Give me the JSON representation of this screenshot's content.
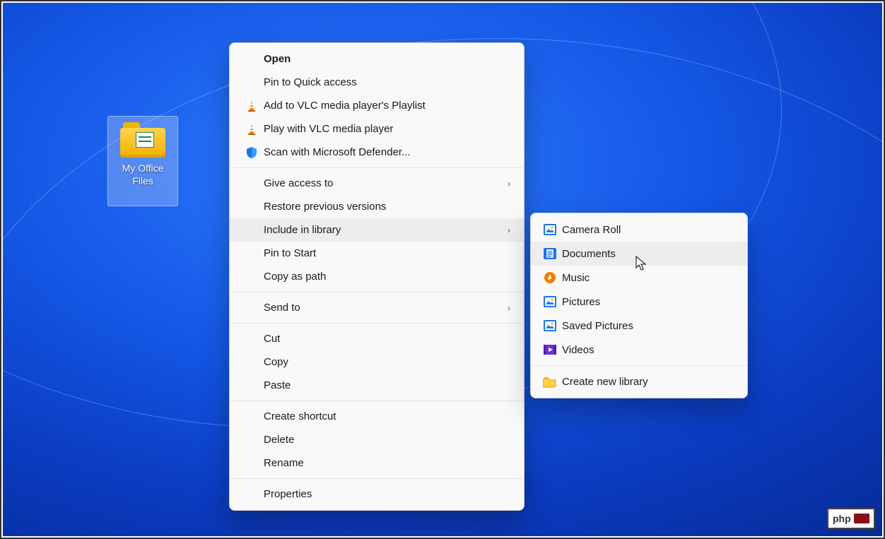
{
  "desktop_icon": {
    "name": "my-office-files-folder",
    "label_line1": "My Office",
    "label_line2": "Files"
  },
  "context_menu": {
    "groups": [
      [
        {
          "key": "open",
          "label": "Open",
          "icon": "",
          "bold": true,
          "submenu": false
        },
        {
          "key": "pin-quick-access",
          "label": "Pin to Quick access",
          "icon": "",
          "submenu": false
        },
        {
          "key": "vlc-add-playlist",
          "label": "Add to VLC media player's Playlist",
          "icon": "vlc-cone-icon",
          "submenu": false
        },
        {
          "key": "vlc-play",
          "label": "Play with VLC media player",
          "icon": "vlc-cone-icon",
          "submenu": false
        },
        {
          "key": "defender-scan",
          "label": "Scan with Microsoft Defender...",
          "icon": "defender-shield-icon",
          "submenu": false
        }
      ],
      [
        {
          "key": "give-access-to",
          "label": "Give access to",
          "icon": "",
          "submenu": true
        },
        {
          "key": "restore-previous",
          "label": "Restore previous versions",
          "icon": "",
          "submenu": false
        },
        {
          "key": "include-in-library",
          "label": "Include in library",
          "icon": "",
          "submenu": true,
          "hover": true
        },
        {
          "key": "pin-to-start",
          "label": "Pin to Start",
          "icon": "",
          "submenu": false
        },
        {
          "key": "copy-as-path",
          "label": "Copy as path",
          "icon": "",
          "submenu": false
        }
      ],
      [
        {
          "key": "send-to",
          "label": "Send to",
          "icon": "",
          "submenu": true
        }
      ],
      [
        {
          "key": "cut",
          "label": "Cut",
          "icon": "",
          "submenu": false
        },
        {
          "key": "copy",
          "label": "Copy",
          "icon": "",
          "submenu": false
        },
        {
          "key": "paste",
          "label": "Paste",
          "icon": "",
          "submenu": false
        }
      ],
      [
        {
          "key": "create-shortcut",
          "label": "Create shortcut",
          "icon": "",
          "submenu": false
        },
        {
          "key": "delete",
          "label": "Delete",
          "icon": "",
          "submenu": false
        },
        {
          "key": "rename",
          "label": "Rename",
          "icon": "",
          "submenu": false
        }
      ],
      [
        {
          "key": "properties",
          "label": "Properties",
          "icon": "",
          "submenu": false
        }
      ]
    ]
  },
  "submenu": {
    "groups": [
      [
        {
          "key": "camera-roll",
          "label": "Camera Roll",
          "icon": "picture-library-icon"
        },
        {
          "key": "documents",
          "label": "Documents",
          "icon": "document-library-icon",
          "hover": true
        },
        {
          "key": "music",
          "label": "Music",
          "icon": "music-library-icon"
        },
        {
          "key": "pictures",
          "label": "Pictures",
          "icon": "picture-library-icon"
        },
        {
          "key": "saved-pictures",
          "label": "Saved Pictures",
          "icon": "picture-library-icon"
        },
        {
          "key": "videos",
          "label": "Videos",
          "icon": "video-library-icon"
        }
      ],
      [
        {
          "key": "create-new-library",
          "label": "Create new library",
          "icon": "new-library-folder-icon"
        }
      ]
    ]
  },
  "watermark": {
    "text": "php"
  }
}
